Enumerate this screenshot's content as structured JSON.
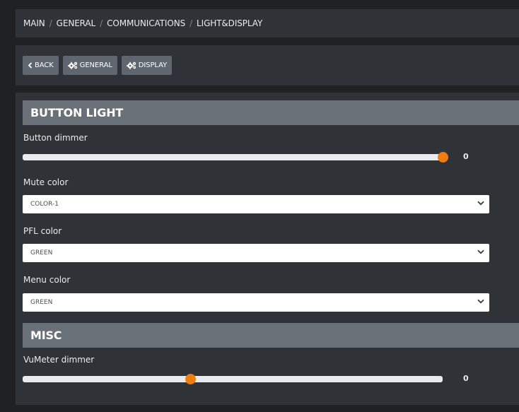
{
  "breadcrumb": {
    "items": [
      "MAIN",
      "GENERAL",
      "COMMUNICATIONS",
      "LIGHT&DISPLAY"
    ],
    "separator": "/"
  },
  "toolbar": {
    "back_label": "BACK",
    "back_icon": "chevron-left-icon",
    "general_label": "GENERAL",
    "general_icon": "cogs-icon",
    "display_label": "DISPLAY",
    "display_icon": "cogs-icon"
  },
  "sections": {
    "button_light": {
      "title": "BUTTON LIGHT",
      "button_dimmer": {
        "label": "Button dimmer",
        "value": "0",
        "slider_position_fraction": 1.0
      },
      "mute_color": {
        "label": "Mute color",
        "selected": "COLOR-1"
      },
      "pfl_color": {
        "label": "PFL color",
        "selected": "GREEN"
      },
      "menu_color": {
        "label": "Menu color",
        "selected": "GREEN"
      }
    },
    "misc": {
      "title": "MISC",
      "vumeter_dimmer": {
        "label": "VuMeter dimmer",
        "value": "0",
        "slider_position_fraction": 0.4
      }
    }
  },
  "colors": {
    "page_background": "#1f2124",
    "panel_background": "#2f3237",
    "section_header": "#6a7078",
    "button": "#5e6670",
    "slider_thumb": "#f07d12",
    "slider_track": "#e9ecef"
  }
}
